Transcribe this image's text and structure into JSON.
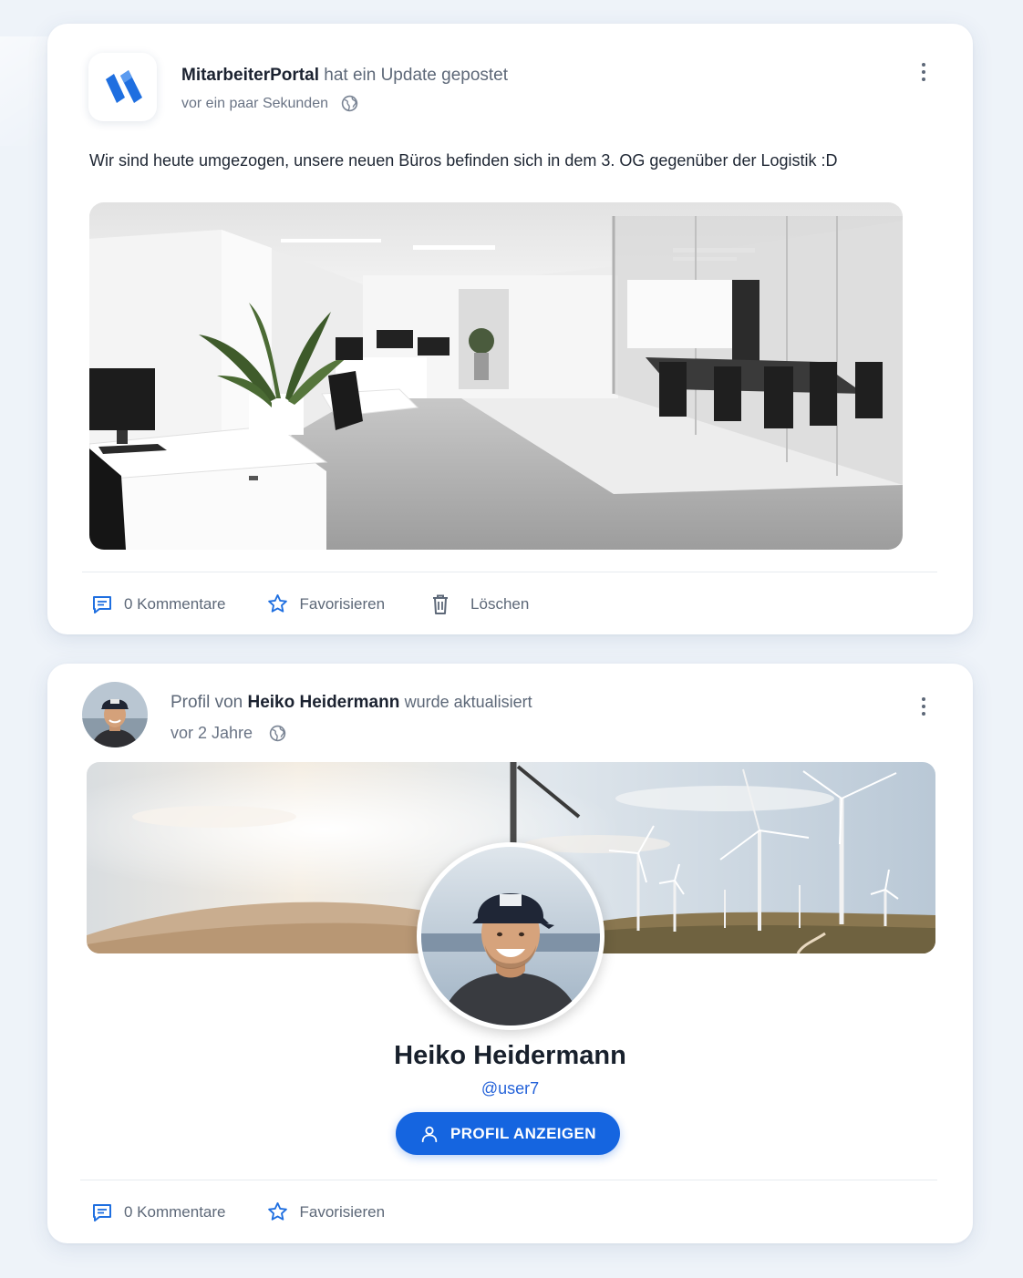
{
  "post1": {
    "author": "MitarbeiterPortal",
    "action_text": "hat ein Update gepostet",
    "time": "vor ein paar Sekunden",
    "body": "Wir sind heute umgezogen, unsere neuen Büros befinden sich in dem 3. OG gegenüber der Logistik :D",
    "actions": {
      "comments": "0 Kommentare",
      "favorite": "Favorisieren",
      "delete": "Löschen"
    }
  },
  "post2": {
    "prefix": "Profil von",
    "name": "Heiko Heidermann",
    "suffix": "wurde aktualisiert",
    "time": "vor 2 Jahre",
    "profile_name": "Heiko Heidermann",
    "handle": "@user7",
    "button_label": "PROFIL ANZEIGEN",
    "actions": {
      "comments": "0 Kommentare",
      "favorite": "Favorisieren"
    }
  },
  "colors": {
    "accent": "#1565e0",
    "icon_blue": "#1f6fe0",
    "text_muted": "#5d6878",
    "background": "#eef3f9"
  },
  "icons": {
    "logo": "mitarbeiterportal-logo",
    "visibility": "globe-icon",
    "menu": "more-vertical-icon",
    "comments": "comment-icon",
    "favorite": "star-icon",
    "delete": "trash-icon",
    "profile": "user-icon"
  }
}
